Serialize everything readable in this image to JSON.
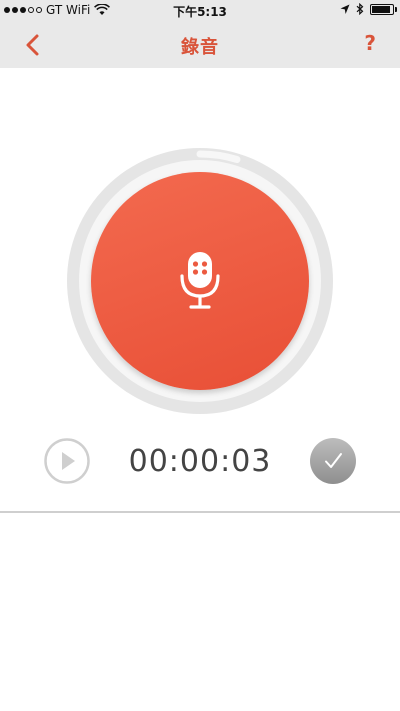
{
  "status_bar": {
    "carrier": "GT WiFi",
    "time": "下午5:13",
    "icons": [
      "signal-icon",
      "wifi-icon",
      "location-icon",
      "bluetooth-icon",
      "battery-icon"
    ]
  },
  "nav": {
    "title": "錄音",
    "back_icon": "chevron-left-icon",
    "help_label": "?"
  },
  "recorder": {
    "elapsed": "00:00:03",
    "play_icon": "play-icon",
    "confirm_icon": "checkmark-icon",
    "mic_icon": "microphone-icon"
  },
  "colors": {
    "accent": "#d9543a",
    "record_button": "#ec5a40",
    "topbar_bg": "#e9e9e9",
    "confirm_bg": "#a8a8a8"
  }
}
